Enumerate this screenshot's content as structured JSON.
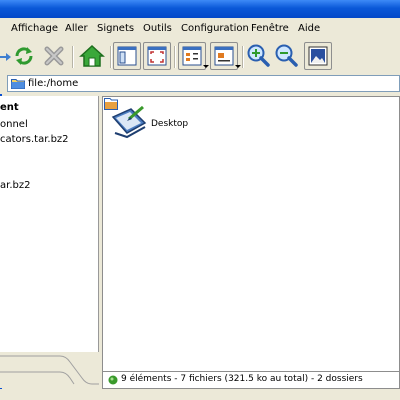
{
  "menubar": {
    "items": [
      "Affichage",
      "Aller",
      "Signets",
      "Outils",
      "Configuration",
      "Fenêtre",
      "Aide"
    ]
  },
  "toolbar": {
    "buttons": [
      "reload-icon",
      "stop-icon",
      "home-icon",
      "split-view-icon",
      "fullscreen-icon",
      "icon-view-icon",
      "detail-view-icon",
      "zoom-in-icon",
      "zoom-out-icon",
      "preview-icon"
    ]
  },
  "location": {
    "value": "file:/home"
  },
  "sidebar": {
    "items": [
      "ent",
      "onnel",
      "cators.tar.bz2",
      "ar.bz2"
    ]
  },
  "main": {
    "items": [
      {
        "label": "Desktop"
      }
    ]
  },
  "status": {
    "text": "9 éléments - 7 fichiers (321.5 ko au total) - 2 dossiers"
  },
  "colors": {
    "title_bar": "#0a58d8",
    "window_bg": "#ece9d8",
    "status_ok": "#3a9a2c"
  }
}
